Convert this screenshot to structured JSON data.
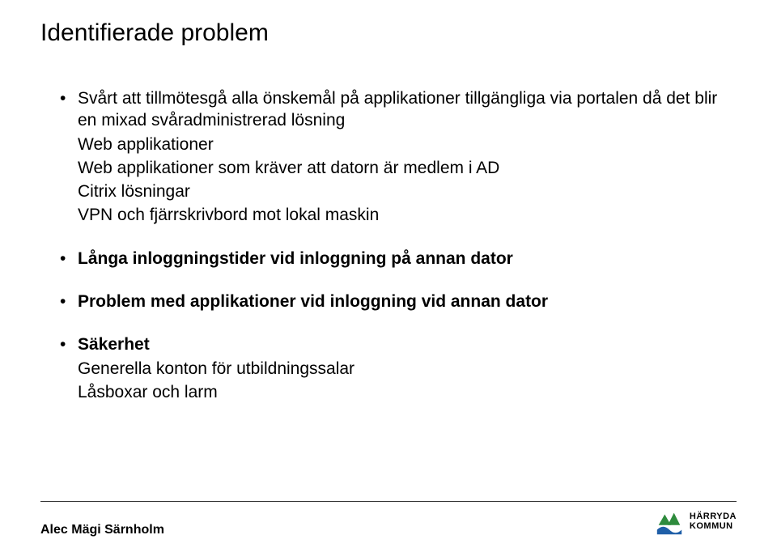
{
  "title": "Identifierade problem",
  "bullets": [
    {
      "lead": "Svårt att tillmötesgå alla önskemål på applikationer tillgängliga via portalen då det blir en mixad svåradministrerad lösning",
      "bold": false,
      "subs": [
        "Web applikationer",
        "Web applikationer som kräver att datorn är medlem i AD",
        "Citrix lösningar",
        "VPN och fjärrskrivbord mot lokal maskin"
      ]
    },
    {
      "lead": "Långa inloggningstider vid inloggning på annan dator",
      "bold": true,
      "subs": []
    },
    {
      "lead": "Problem med applikationer vid inloggning vid annan dator",
      "bold": true,
      "subs": []
    },
    {
      "lead": "Säkerhet",
      "bold": true,
      "subs": [
        "Generella konton för utbildningssalar",
        "Låsboxar och larm"
      ]
    }
  ],
  "footer": {
    "author": "Alec Mägi Särnholm",
    "logo_line1": "HÄRRYDA",
    "logo_line2": "KOMMUN"
  },
  "colors": {
    "logo_green": "#2e8b3d",
    "logo_blue": "#1f5fa8"
  }
}
